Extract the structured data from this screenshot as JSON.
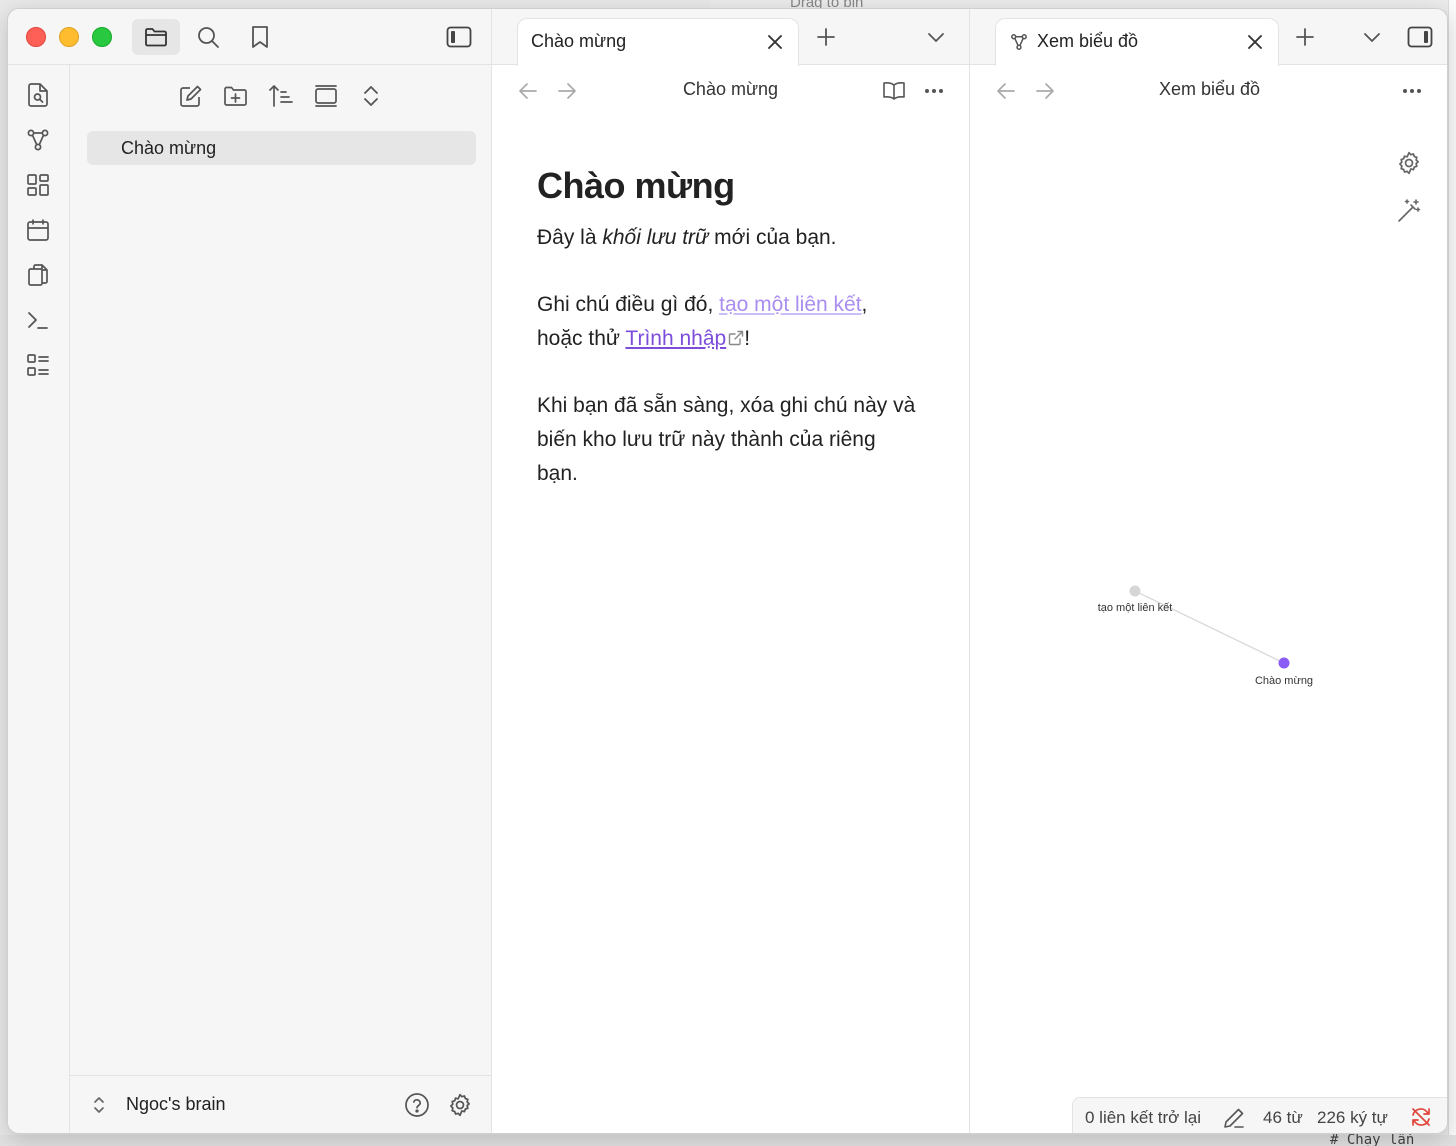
{
  "background": {
    "top_text": "Drag to bin",
    "bottom_text": "# Chạy lần"
  },
  "colors": {
    "accent": "#8a5cf5",
    "link_unresolved": "#a98ef0",
    "link_external": "#7c4ddb",
    "sidebar_bg": "#f6f6f6",
    "close_red": "#fe5f57",
    "minimize_yellow": "#febc2e",
    "zoom_green": "#28c840",
    "sync_error": "#e0453a"
  },
  "titlebar": {
    "icons": [
      "folder-icon",
      "search-icon",
      "bookmark-icon",
      "sidebar-toggle-icon"
    ]
  },
  "ribbon": {
    "icons": [
      "quick-switcher-icon",
      "graph-view-icon",
      "canvas-icon",
      "daily-note-icon",
      "templates-icon",
      "command-palette-icon",
      "outline-icon"
    ]
  },
  "sidebar": {
    "actions": [
      "new-note-icon",
      "new-folder-icon",
      "sort-icon",
      "collapse-view-icon",
      "expand-collapse-icon"
    ],
    "files": [
      {
        "label": "Chào mừng"
      }
    ],
    "vault_name": "Ngoc's brain"
  },
  "pane_left": {
    "tab_label": "Chào mừng",
    "nav_title": "Chào mừng",
    "note": {
      "heading": "Chào mừng",
      "p1_before": "Đây là ",
      "p1_italic": "khối lưu trữ",
      "p1_after": " mới của bạn.",
      "p2_before": "Ghi chú điều gì đó, ",
      "p2_link": "tạo một liên kết",
      "p2_mid": ",",
      "p2_line2_before": "hoặc thử ",
      "p2_ext_link": "Trình nhập",
      "p2_after": "!",
      "p3": "Khi bạn đã sẵn sàng, xóa ghi chú này và biến kho lưu trữ này thành của riêng bạn."
    }
  },
  "pane_right": {
    "tab_label": "Xem biểu đồ",
    "nav_title": "Xem biểu đồ",
    "graph": {
      "nodes": [
        {
          "label": "tạo một liên kết",
          "resolved": false
        },
        {
          "label": "Chào mừng",
          "resolved": true
        }
      ]
    },
    "status": {
      "backlinks": "0 liên kết trở lại",
      "words": "46 từ",
      "chars": "226 ký tự"
    }
  }
}
